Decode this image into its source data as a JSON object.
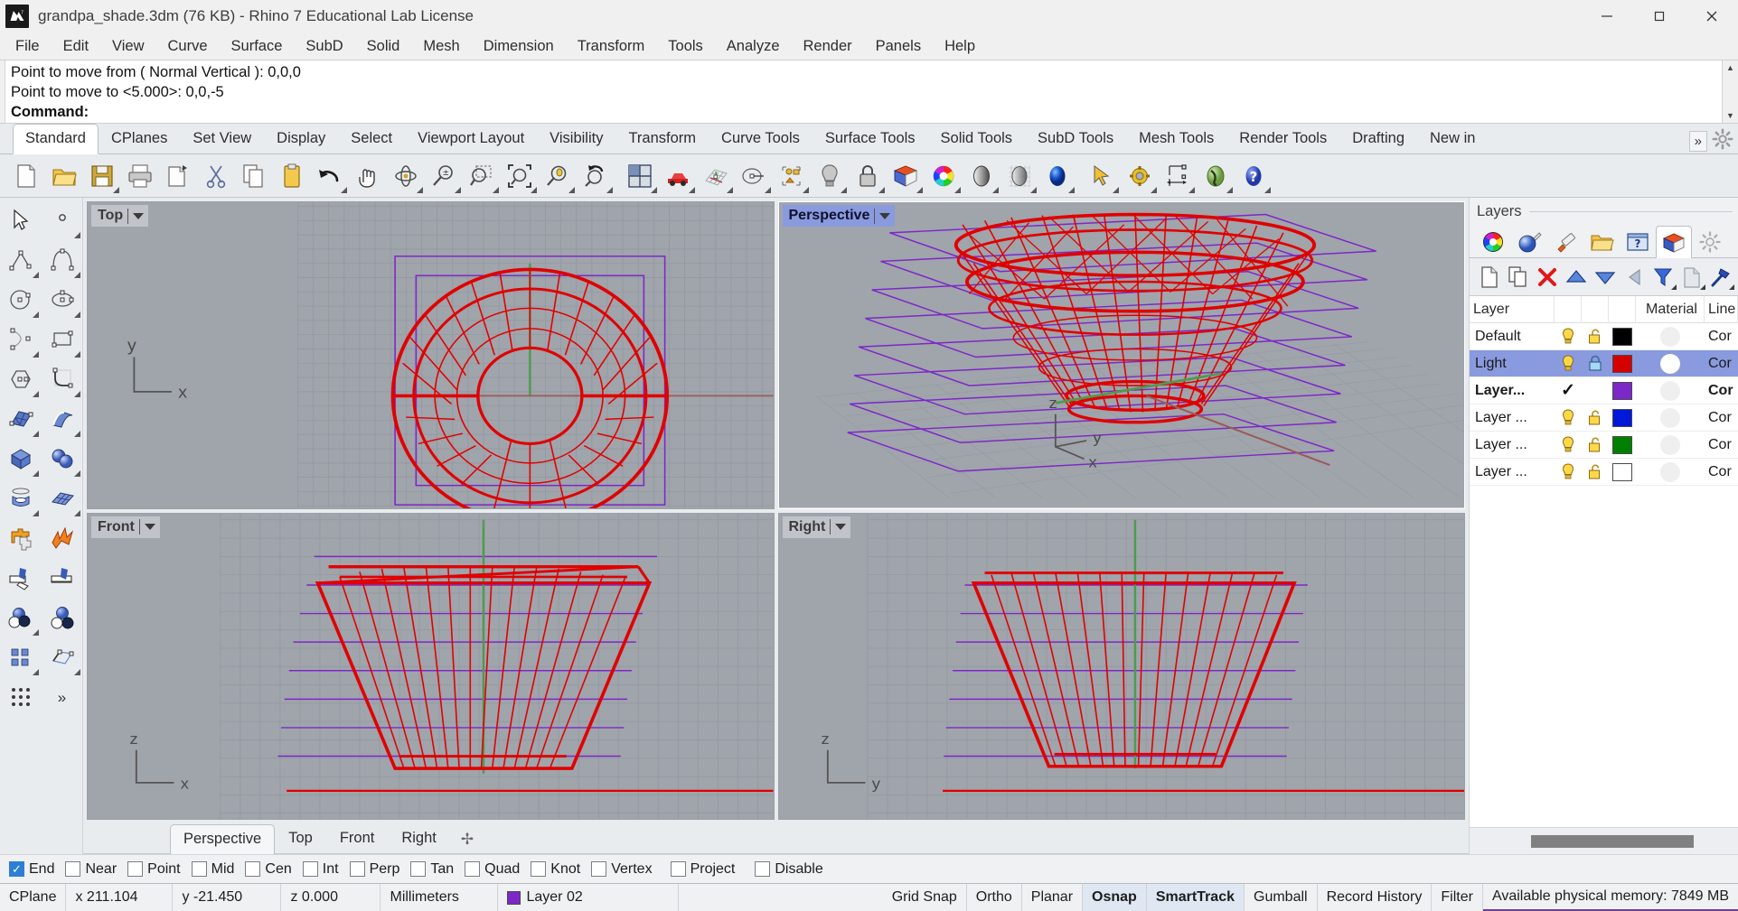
{
  "window": {
    "title": "grandpa_shade.3dm (76 KB) - Rhino 7 Educational Lab License",
    "app_icon": "rhino-logo-icon",
    "minimize": "minimize-icon",
    "maximize": "maximize-icon",
    "close": "close-icon"
  },
  "menubar": {
    "items": [
      {
        "label": "File"
      },
      {
        "label": "Edit"
      },
      {
        "label": "View"
      },
      {
        "label": "Curve"
      },
      {
        "label": "Surface"
      },
      {
        "label": "SubD"
      },
      {
        "label": "Solid"
      },
      {
        "label": "Mesh"
      },
      {
        "label": "Dimension"
      },
      {
        "label": "Transform"
      },
      {
        "label": "Tools"
      },
      {
        "label": "Analyze"
      },
      {
        "label": "Render"
      },
      {
        "label": "Panels"
      },
      {
        "label": "Help"
      }
    ]
  },
  "command_area": {
    "history": [
      "Point to move from ( Normal  Vertical ): 0,0,0",
      "Point to move to <5.000>: 0,0,-5"
    ],
    "prompt_label": "Command:",
    "input_value": ""
  },
  "toolbar_tabs": {
    "items": [
      {
        "label": "Standard",
        "active": true
      },
      {
        "label": "CPlanes",
        "active": false
      },
      {
        "label": "Set View",
        "active": false
      },
      {
        "label": "Display",
        "active": false
      },
      {
        "label": "Select",
        "active": false
      },
      {
        "label": "Viewport Layout",
        "active": false
      },
      {
        "label": "Visibility",
        "active": false
      },
      {
        "label": "Transform",
        "active": false
      },
      {
        "label": "Curve Tools",
        "active": false
      },
      {
        "label": "Surface Tools",
        "active": false
      },
      {
        "label": "Solid Tools",
        "active": false
      },
      {
        "label": "SubD Tools",
        "active": false
      },
      {
        "label": "Mesh Tools",
        "active": false
      },
      {
        "label": "Render Tools",
        "active": false
      },
      {
        "label": "Drafting",
        "active": false
      },
      {
        "label": "New in ",
        "active": false
      }
    ],
    "overflow_label": "»",
    "gear": "gear-icon"
  },
  "main_toolbar": {
    "buttons": [
      {
        "name": "new-file-icon",
        "corner": false
      },
      {
        "name": "open-file-icon",
        "corner": false
      },
      {
        "name": "save-file-icon",
        "corner": true
      },
      {
        "name": "print-icon",
        "corner": false
      },
      {
        "name": "copy-page-icon",
        "corner": false
      },
      {
        "name": "cut-icon",
        "corner": false
      },
      {
        "name": "copy-icon",
        "corner": false
      },
      {
        "name": "paste-icon",
        "corner": false
      },
      {
        "name": "undo-icon",
        "corner": true
      },
      {
        "name": "pan-hand-icon",
        "corner": false
      },
      {
        "name": "rotate-view-icon",
        "corner": true
      },
      {
        "name": "zoom-in-out-icon",
        "corner": true
      },
      {
        "name": "zoom-window-icon",
        "corner": true
      },
      {
        "name": "zoom-extents-icon",
        "corner": true
      },
      {
        "name": "zoom-selected-icon",
        "corner": true
      },
      {
        "name": "zoom-previous-icon",
        "corner": true
      },
      {
        "name": "viewport-layout-icon",
        "corner": true
      },
      {
        "name": "named-view-car-icon",
        "corner": true
      },
      {
        "name": "cplane-grid-icon",
        "corner": true
      },
      {
        "name": "rotate-cplane-icon",
        "corner": true
      },
      {
        "name": "object-properties-icon",
        "corner": true
      },
      {
        "name": "light-bulb-icon",
        "corner": true
      },
      {
        "name": "lock-icon",
        "corner": true
      },
      {
        "name": "layers-icon",
        "corner": true
      },
      {
        "name": "color-wheel-icon",
        "corner": true
      },
      {
        "name": "shaded-display-icon",
        "corner": true
      },
      {
        "name": "ghosted-display-icon",
        "corner": true
      },
      {
        "name": "rendered-display-icon",
        "corner": true
      },
      {
        "name": "select-arrow-icon",
        "corner": true
      },
      {
        "name": "options-gear-icon",
        "corner": true
      },
      {
        "name": "dimension-icon",
        "corner": true
      },
      {
        "name": "render-globe-icon",
        "corner": true
      },
      {
        "name": "help-icon",
        "corner": true
      }
    ]
  },
  "sidebar_tools": {
    "rows": [
      [
        {
          "name": "select-arrow-icon",
          "corner": false
        },
        {
          "name": "point-icon",
          "corner": true
        }
      ],
      [
        {
          "name": "polyline-icon",
          "corner": true
        },
        {
          "name": "curve-interp-icon",
          "corner": true
        }
      ],
      [
        {
          "name": "circle-icon",
          "corner": true
        },
        {
          "name": "ellipse-icon",
          "corner": true
        }
      ],
      [
        {
          "name": "arc-icon",
          "corner": true
        },
        {
          "name": "rectangle-icon",
          "corner": true
        }
      ],
      [
        {
          "name": "polygon-icon",
          "corner": true
        },
        {
          "name": "fillet-curve-icon",
          "corner": true
        }
      ],
      [
        {
          "name": "surface-from-points-icon",
          "corner": true
        },
        {
          "name": "extrude-surface-icon",
          "corner": true
        }
      ],
      [
        {
          "name": "box-solid-icon",
          "corner": true
        },
        {
          "name": "sphere-union-icon",
          "corner": true
        }
      ],
      [
        {
          "name": "revolve-icon",
          "corner": true
        },
        {
          "name": "mesh-plane-icon",
          "corner": true
        }
      ],
      [
        {
          "name": "boolean-union-icon",
          "corner": false
        },
        {
          "name": "explode-icon",
          "corner": false
        }
      ],
      [
        {
          "name": "trim-icon",
          "corner": false
        },
        {
          "name": "split-icon",
          "corner": false
        }
      ],
      [
        {
          "name": "boolean-difference-icon",
          "corner": true
        },
        {
          "name": "boolean-intersect-icon",
          "corner": false
        }
      ],
      [
        {
          "name": "array-icon",
          "corner": true
        },
        {
          "name": "cage-edit-icon",
          "corner": true
        }
      ],
      [
        {
          "name": "grid-snap-tools-icon",
          "corner": false
        },
        {
          "name": "more-tools-icon",
          "corner": false
        }
      ]
    ],
    "more_label": "»"
  },
  "viewports": [
    {
      "name": "Top",
      "active": false,
      "axes": {
        "v": "y",
        "h": "x"
      }
    },
    {
      "name": "Perspective",
      "active": true,
      "axes": {
        "v": "z",
        "h1": "y",
        "h2": "x"
      }
    },
    {
      "name": "Front",
      "active": false,
      "axes": {
        "v": "z",
        "h": "x"
      }
    },
    {
      "name": "Right",
      "active": false,
      "axes": {
        "v": "z",
        "h": "y"
      }
    }
  ],
  "viewport_tabs": {
    "items": [
      {
        "label": "Perspective",
        "active": true
      },
      {
        "label": "Top",
        "active": false
      },
      {
        "label": "Front",
        "active": false
      },
      {
        "label": "Right",
        "active": false
      }
    ],
    "add_label": "✢"
  },
  "layers_panel": {
    "title": "Layers",
    "icon_tabs": [
      {
        "name": "color-wheel-icon",
        "active": false
      },
      {
        "name": "render-material-icon",
        "active": false
      },
      {
        "name": "paint-tube-icon",
        "active": false
      },
      {
        "name": "open-folder-icon",
        "active": false
      },
      {
        "name": "named-view-icon",
        "active": false
      },
      {
        "name": "layers-icon",
        "active": true
      },
      {
        "name": "panel-settings-gear-icon",
        "active": false
      }
    ],
    "tools": [
      {
        "name": "new-layer-icon",
        "corner": false
      },
      {
        "name": "duplicate-layer-icon",
        "corner": false
      },
      {
        "name": "delete-layer-icon",
        "corner": false
      },
      {
        "name": "move-layer-up-icon",
        "corner": false
      },
      {
        "name": "move-layer-down-icon",
        "corner": false
      },
      {
        "name": "collapse-layer-icon",
        "corner": false
      },
      {
        "name": "filter-layer-icon",
        "corner": true
      },
      {
        "name": "layer-properties-icon",
        "corner": true
      },
      {
        "name": "layer-tools-icon",
        "corner": true
      }
    ],
    "columns": [
      "Layer",
      "",
      "",
      "",
      "",
      "Material",
      "Line"
    ],
    "rows": [
      {
        "name": "Default",
        "on": true,
        "lock": "unlocked",
        "color": "#000000",
        "material": "gray",
        "linetype": "Cor",
        "current": false,
        "selected": false
      },
      {
        "name": "Light",
        "on": true,
        "lock": "locked",
        "color": "#d40000",
        "material": "white",
        "linetype": "Cor",
        "current": false,
        "selected": true
      },
      {
        "name": "Layer...",
        "on": false,
        "lock": "none",
        "color": "#7c28c8",
        "material": "gray",
        "linetype": "Cor",
        "current": true,
        "selected": false
      },
      {
        "name": "Layer ...",
        "on": true,
        "lock": "unlocked",
        "color": "#0018d8",
        "material": "gray",
        "linetype": "Cor",
        "current": false,
        "selected": false
      },
      {
        "name": "Layer ...",
        "on": true,
        "lock": "unlocked",
        "color": "#008000",
        "material": "gray",
        "linetype": "Cor",
        "current": false,
        "selected": false
      },
      {
        "name": "Layer ...",
        "on": true,
        "lock": "unlocked",
        "color": "#ffffff",
        "material": "gray",
        "linetype": "Cor",
        "current": false,
        "selected": false
      }
    ]
  },
  "osnap_bar": {
    "items": [
      {
        "label": "End",
        "checked": true
      },
      {
        "label": "Near",
        "checked": false
      },
      {
        "label": "Point",
        "checked": false
      },
      {
        "label": "Mid",
        "checked": false
      },
      {
        "label": "Cen",
        "checked": false
      },
      {
        "label": "Int",
        "checked": false
      },
      {
        "label": "Perp",
        "checked": false
      },
      {
        "label": "Tan",
        "checked": false
      },
      {
        "label": "Quad",
        "checked": false
      },
      {
        "label": "Knot",
        "checked": false
      },
      {
        "label": "Vertex",
        "checked": false
      },
      {
        "label": "Project",
        "checked": false
      },
      {
        "label": "Disable",
        "checked": false
      }
    ]
  },
  "status_bar": {
    "cplane": "CPlane",
    "x": "x 211.104",
    "y": "y -21.450",
    "z": "z 0.000",
    "units": "Millimeters",
    "layer": "Layer 02",
    "layer_color": "#7c28c8",
    "toggles": [
      {
        "label": "Grid Snap",
        "on": false
      },
      {
        "label": "Ortho",
        "on": false
      },
      {
        "label": "Planar",
        "on": false
      },
      {
        "label": "Osnap",
        "on": true
      },
      {
        "label": "SmartTrack",
        "on": true
      },
      {
        "label": "Gumball",
        "on": false
      },
      {
        "label": "Record History",
        "on": false
      },
      {
        "label": "Filter",
        "on": false
      }
    ],
    "memory": "Available physical memory: 7849 MB"
  },
  "colors": {
    "geometry_red": "#e00000",
    "construction_purple": "#7c28c8",
    "viewport_bg": "#a0a4ab",
    "active_highlight": "#8a9adf",
    "axis_green": "#4f9a4f",
    "axis_red": "#9a4f4f"
  }
}
